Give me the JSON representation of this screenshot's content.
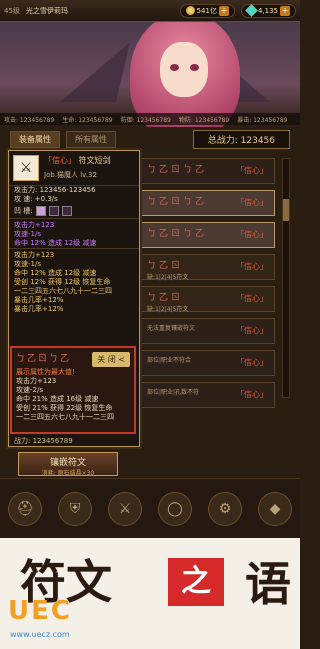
{
  "topbar": {
    "level": "45级",
    "name": "光之雪伊莉玛",
    "gold": "541亿",
    "gems": "4,135"
  },
  "banner": {
    "stats": [
      "攻击: 123456789",
      "生命: 123456789",
      "防御: 123456789",
      "物防: 123456789",
      "暴击: 123456789"
    ]
  },
  "tabs": [
    {
      "label": "装备属性",
      "active": true
    },
    {
      "label": "所有属性",
      "active": false
    }
  ],
  "power_label": "总战力: 123456",
  "list": [
    {
      "runes": "ㄅ乙ㄖㄅ乙",
      "tag": "「信心」",
      "sub": "",
      "state": "normal"
    },
    {
      "runes": "ㄅ乙ㄖㄅ乙",
      "tag": "「信心」",
      "sub": "",
      "state": "selected"
    },
    {
      "runes": "ㄅ乙ㄖㄅ乙",
      "tag": "「信心」",
      "sub": "",
      "state": "selected"
    },
    {
      "runes": "ㄅ乙ㄖ",
      "tag": "「信心」",
      "sub": "缺:1|2|4|5符文",
      "state": "alt"
    },
    {
      "runes": "ㄅ乙ㄖ",
      "tag": "「信心」",
      "sub": "缺:1|2|4|5符文",
      "state": "alt"
    },
    {
      "runes": "",
      "tag": "「信心」",
      "sub": "无法重复镶嵌符文",
      "state": "normal"
    },
    {
      "runes": "",
      "tag": "「信心」",
      "sub": "部位|职业不符合",
      "state": "normal"
    },
    {
      "runes": "",
      "tag": "「信心」",
      "sub": "部位|职业|孔数不符",
      "state": "normal"
    }
  ],
  "tip": {
    "title_q": "「信心」",
    "title_name": "符文短剑",
    "job": "Job.猫魔人 lv.32",
    "atk": "攻击力: 123456-123456",
    "spd": "攻  速: +0.3/s",
    "socket_label": "凹  槽:",
    "bonus1": [
      "攻击力+123",
      "攻速-1/s",
      "命中 12% 造成 12级 减速"
    ],
    "bonus2": [
      "攻击力+123",
      "攻速-1/s",
      "命中 12% 造成 12级 减速",
      "受创 12% 获得 12级 恢复生命",
      "一二三四五六七八九十一二三四",
      "暴击几率+12%",
      "暴击几率+12%"
    ],
    "popup_runes": "ㄅ乙ㄖㄅ乙",
    "popup_close": "关 闭 <",
    "popup_max": "展示属性为最大值!",
    "popup_lines": [
      "攻击力+123",
      "攻速-2/s",
      "命中 21% 造成 16级 减速",
      "受创 21% 获得 22级 恢复生命",
      "一二三四五六七八九十一二三四"
    ]
  },
  "power2": "战力: 123456789",
  "inlay": {
    "label": "镶嵌符文",
    "cost": "消耗: 原石结晶×30"
  },
  "promo": {
    "char1": "符文",
    "char_zhi": "之",
    "char2": "语",
    "brand": "UEC",
    "url": "www.uecz.com"
  }
}
